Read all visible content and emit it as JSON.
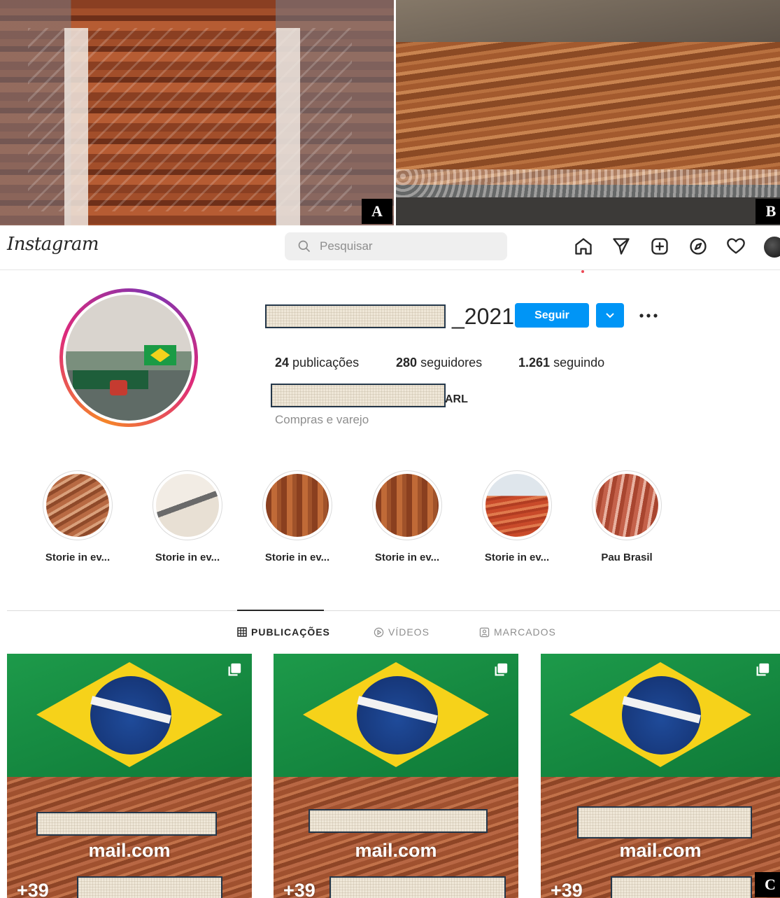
{
  "panels": {
    "a_label": "A",
    "b_label": "B",
    "c_label": "C"
  },
  "header": {
    "logo": "Instagram",
    "search_placeholder": "Pesquisar"
  },
  "icons": {
    "search": "search-icon",
    "home": "home-icon",
    "direct": "paper-plane-icon",
    "new_post": "plus-square-icon",
    "explore": "compass-icon",
    "activity": "heart-icon",
    "profile": "avatar",
    "posts_tab": "grid-icon",
    "videos_tab": "play-circle-icon",
    "tagged_tab": "tag-icon",
    "multi": "multiple-images-icon"
  },
  "profile": {
    "username_suffix": "_2021",
    "follow_label": "Seguir",
    "stats": [
      {
        "value": "24",
        "label": "publicações"
      },
      {
        "value": "280",
        "label": "seguidores"
      },
      {
        "value": "1.261",
        "label": "seguindo"
      }
    ],
    "fullname_suffix": "ARL",
    "category": "Compras e varejo"
  },
  "highlights": [
    {
      "label": "Storie in ev..."
    },
    {
      "label": "Storie in ev..."
    },
    {
      "label": "Storie in ev..."
    },
    {
      "label": "Storie in ev..."
    },
    {
      "label": "Storie in ev..."
    },
    {
      "label": "Pau Brasil"
    }
  ],
  "tabs": [
    {
      "label": "PUBLICAÇÕES",
      "active": true
    },
    {
      "label": "VÍDEOS",
      "active": false
    },
    {
      "label": "MARCADOS",
      "active": false
    }
  ],
  "posts": [
    {
      "mail_text": "mail.com",
      "phone_prefix": "+39"
    },
    {
      "mail_text": "mail.com",
      "phone_prefix": "+39"
    },
    {
      "mail_text": "mail.com",
      "phone_prefix": "+39"
    }
  ],
  "colors": {
    "accent": "#0095f6",
    "notification_dot": "#ed4956",
    "text_primary": "#262626",
    "text_secondary": "#8e8e8e"
  }
}
